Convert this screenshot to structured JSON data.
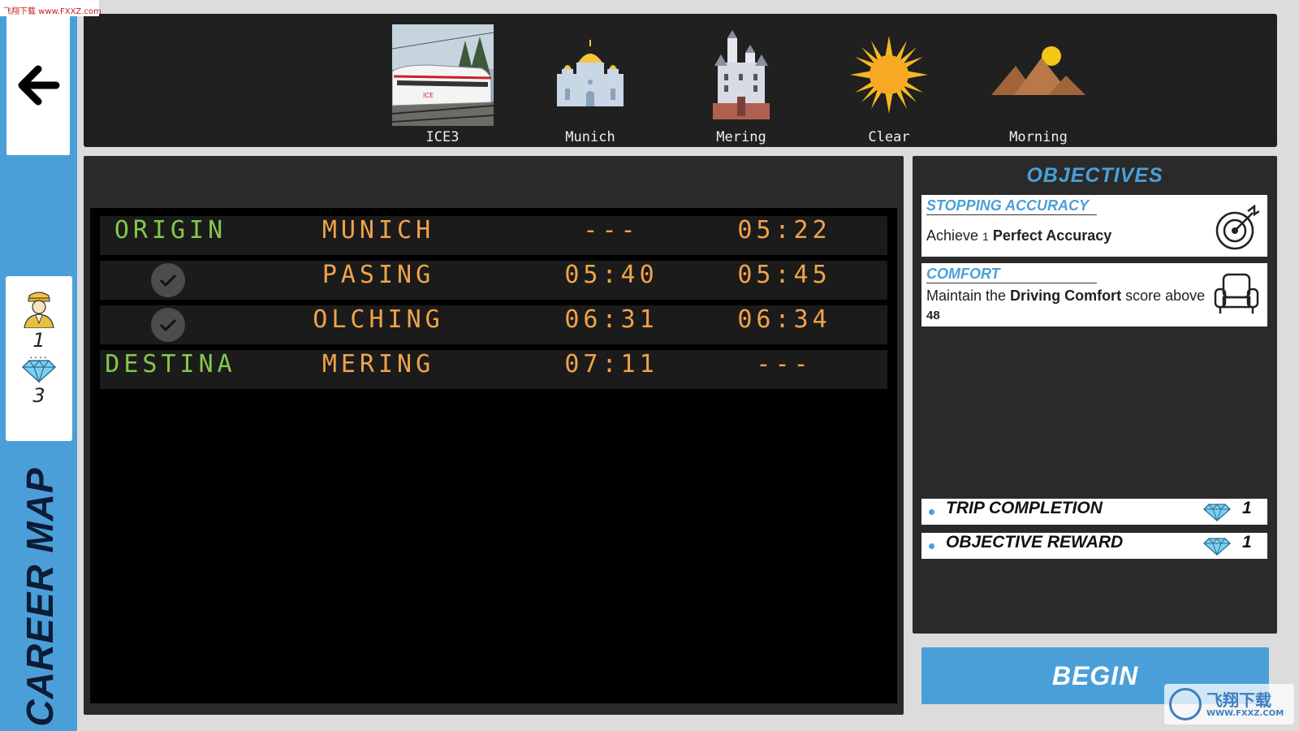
{
  "watermark_top": "飞翔下载 www.FXXZ.com",
  "sidebar": {
    "rank_level": "1",
    "rank_gems": "3",
    "career_label": "CAREER MAP"
  },
  "route": [
    {
      "label": "ICE3",
      "icon": "train-photo"
    },
    {
      "label": "Munich",
      "icon": "cathedral-icon"
    },
    {
      "label": "Mering",
      "icon": "castle-icon"
    },
    {
      "label": "Clear",
      "icon": "sun-icon"
    },
    {
      "label": "Morning",
      "icon": "mountain-sun-icon"
    }
  ],
  "timetable": [
    {
      "type": "ORIGIN",
      "station": "MUNICH",
      "arrival": "---",
      "departure": "05:22",
      "checked": false
    },
    {
      "type": "",
      "station": "PASING",
      "arrival": "05:40",
      "departure": "05:45",
      "checked": true
    },
    {
      "type": "",
      "station": "OLCHING",
      "arrival": "06:31",
      "departure": "06:34",
      "checked": true
    },
    {
      "type": "DESTINA",
      "station": "MERING",
      "arrival": "07:11",
      "departure": "---",
      "checked": false
    }
  ],
  "objectives": {
    "title": "OBJECTIVES",
    "items": [
      {
        "title": "STOPPING ACCURACY",
        "pre": "Achieve ",
        "num": "1",
        "bold": "Perfect Accuracy",
        "post": "",
        "value": "",
        "icon": "target-icon"
      },
      {
        "title": "COMFORT",
        "pre": "Maintain the ",
        "num": "",
        "bold": "Driving Comfort",
        "post": " score above",
        "value": "48",
        "icon": "armchair-icon"
      }
    ],
    "rewards": [
      {
        "label": "TRIP COMPLETION",
        "count": "1"
      },
      {
        "label": "OBJECTIVE REWARD",
        "count": "1"
      }
    ]
  },
  "begin_label": "BEGIN",
  "watermark_br": {
    "line1": "飞翔下载",
    "line2": "WWW.FXXZ.COM"
  },
  "colors": {
    "accent": "#4a9fd9",
    "board_green": "#84c84a",
    "board_amber": "#f0a34a"
  }
}
